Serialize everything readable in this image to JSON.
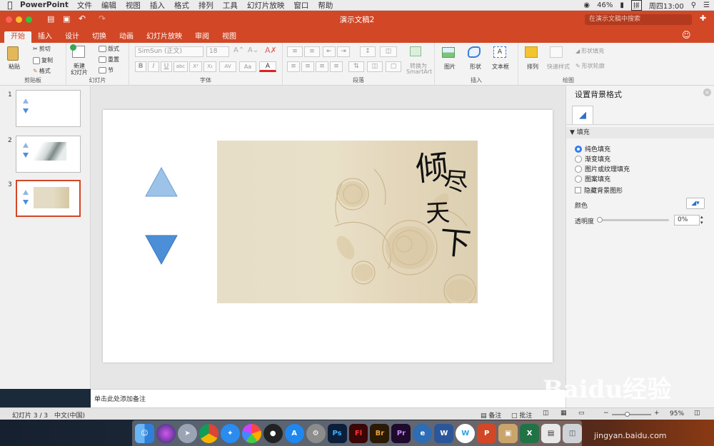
{
  "menubar": {
    "app": "PowerPoint",
    "items": [
      "文件",
      "编辑",
      "视图",
      "插入",
      "格式",
      "排列",
      "工具",
      "幻灯片放映",
      "窗口",
      "帮助"
    ],
    "battery": "46%",
    "input_method": "拼",
    "clock": "周四13:00"
  },
  "window": {
    "title": "演示文稿2",
    "search_placeholder": "在演示文稿中搜索"
  },
  "tabs": [
    "开始",
    "插入",
    "设计",
    "切换",
    "动画",
    "幻灯片放映",
    "审阅",
    "视图"
  ],
  "ribbon": {
    "clipboard": {
      "paste": "粘贴",
      "cut": "剪切",
      "copy": "复制",
      "format": "格式",
      "label": "剪贴板"
    },
    "slides": {
      "new_slide_1": "新建",
      "new_slide_2": "幻灯片",
      "layout": "版式",
      "reset": "重置",
      "section": "节",
      "label": "幻灯片"
    },
    "font": {
      "name": "SimSun (正文)",
      "size": "18",
      "label": "字体"
    },
    "paragraph": {
      "label": "段落",
      "smartart_1": "转换为",
      "smartart_2": "SmartArt"
    },
    "insert": {
      "picture": "图片",
      "shape": "形状",
      "textbox": "文本框",
      "label": "插入"
    },
    "drawing": {
      "arrange": "排列",
      "quick_styles": "快速样式",
      "shape_fill": "形状填充",
      "shape_outline": "形状轮廓",
      "label": "绘图"
    }
  },
  "slides_panel": [
    {
      "number": "1"
    },
    {
      "number": "2"
    },
    {
      "number": "3"
    }
  ],
  "slide": {
    "calligraphy": [
      "倾",
      "尽",
      "天",
      "下"
    ]
  },
  "notes_placeholder": "单击此处添加备注",
  "format_pane": {
    "title": "设置背景格式",
    "section": "填充",
    "options": [
      "纯色填充",
      "渐变填充",
      "图片或纹理填充",
      "图案填充"
    ],
    "selected_option": "纯色填充",
    "hide_bg_graphics": "隐藏背景图形",
    "color_label": "颜色",
    "transparency_label": "透明度",
    "transparency_value": "0%"
  },
  "statusbar": {
    "slide_info": "幻灯片 3 / 3",
    "language": "中文(中国)",
    "notes": "备注",
    "comments": "批注",
    "zoom": "95%"
  },
  "dock": [
    "Finder",
    "Siri",
    "Launchpad",
    "Chrome",
    "Safari",
    "Photos",
    "QQ",
    "App Store",
    "System Preferences",
    "Ps",
    "Fl",
    "Br",
    "Pr",
    "Edge",
    "W",
    "Wunderlist",
    "P",
    "Archive",
    "X",
    "Preview",
    "Trash"
  ],
  "watermark": {
    "main": "Baidu经验",
    "sub": "jingyan.baidu.com"
  }
}
